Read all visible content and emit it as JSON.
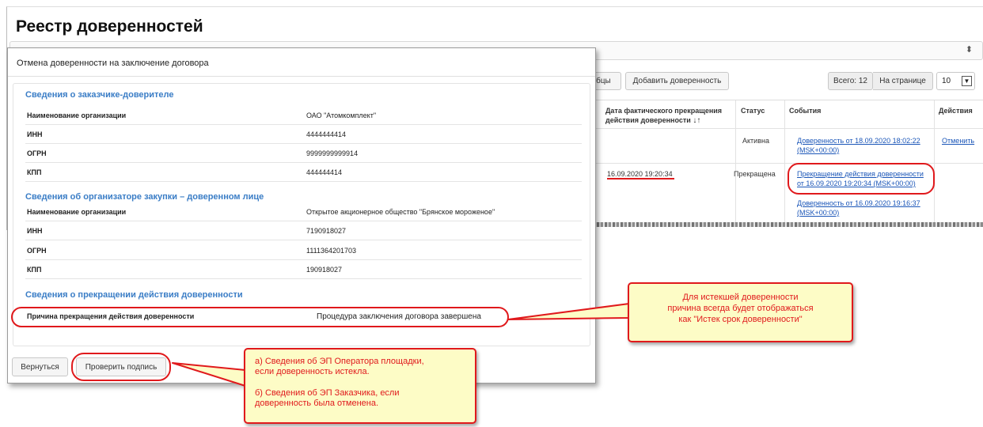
{
  "page": {
    "title": "Реестр доверенностей"
  },
  "toolbar": {
    "columns_label": "лбцы",
    "add_label": "Добавить доверенность",
    "total_label": "Всего: 12",
    "per_page_label": "На странице",
    "per_page_value": "10"
  },
  "table": {
    "headers": {
      "date": "Дата фактического прекращения действия доверенности",
      "status": "Статус",
      "events": "События",
      "actions": "Действия"
    },
    "row1": {
      "status": "Активна",
      "event": "Доверенность от 18.09.2020 18:02:22 (MSK+00:00)",
      "action": "Отменить"
    },
    "row2": {
      "date": "16.09.2020 19:20:34",
      "status": "Прекращена",
      "event1": "Прекращение действия доверенности от 16.09.2020 19:20:34 (MSK+00:00)",
      "event2": "Доверенность от 16.09.2020 19:16:37 (MSK+00:00)"
    }
  },
  "modal": {
    "title": "Отмена доверенности на заключение договора",
    "customer": {
      "heading": "Сведения о заказчике-доверителе",
      "org_label": "Наименование организации",
      "org_value": "ОАО \"Атомкомплект\"",
      "inn_label": "ИНН",
      "inn_value": "4444444414",
      "ogrn_label": "ОГРН",
      "ogrn_value": "9999999999914",
      "kpp_label": "КПП",
      "kpp_value": "444444414"
    },
    "organizer": {
      "heading": "Сведения об организаторе закупки – доверенном лице",
      "org_label": "Наименование организации",
      "org_value": "Открытое акционерное общество \"Брянское мороженое\"",
      "inn_label": "ИНН",
      "inn_value": "7190918027",
      "ogrn_label": "ОГРН",
      "ogrn_value": "1111364201703",
      "kpp_label": "КПП",
      "kpp_value": "190918027"
    },
    "termination": {
      "heading": "Сведения о прекращении действия доверенности",
      "reason_label": "Причина прекращения действия доверенности",
      "reason_value": "Процедура заключения договора завершена"
    },
    "back_label": "Вернуться",
    "check_label": "Проверить подпись"
  },
  "callouts": {
    "right_line1": "Для истекшей доверенности",
    "right_line2": "причина всегда будет отображаться",
    "right_line3": "как \"Истек срок доверенности\"",
    "bottom_a1": "а) Сведения об ЭП Оператора площадки,",
    "bottom_a2": "если доверенность истекла.",
    "bottom_b1": "б) Сведения об ЭП Заказчика, если",
    "bottom_b2": "доверенность была отменена."
  },
  "colors": {
    "accent_link": "#1b56b8",
    "section_heading": "#3a7dc6",
    "annotation_red": "#e0191c",
    "callout_bg": "#fdfcc6"
  },
  "icons": [
    "sort-icon",
    "dropdown-caret-icon",
    "select-arrows-icon"
  ]
}
